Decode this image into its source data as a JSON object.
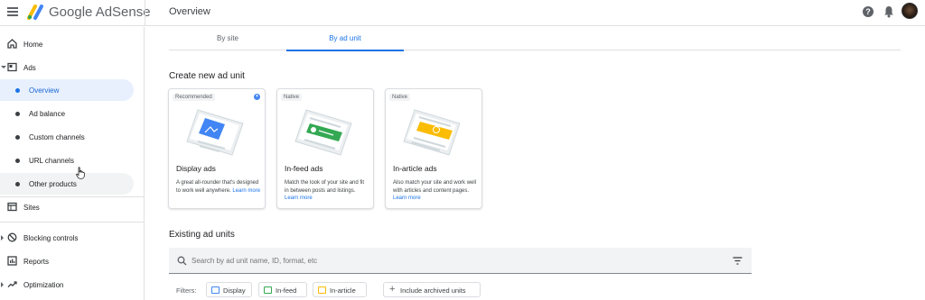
{
  "header": {
    "brand": "Google AdSense",
    "page_title": "Overview",
    "help_glyph": "?"
  },
  "sidebar": {
    "items": [
      {
        "label": "Home",
        "icon": "home-icon"
      },
      {
        "label": "Ads",
        "icon": "ads-icon"
      },
      {
        "label": "Sites",
        "icon": "sites-icon"
      },
      {
        "label": "Blocking controls",
        "icon": "block-icon"
      },
      {
        "label": "Reports",
        "icon": "reports-icon"
      },
      {
        "label": "Optimization",
        "icon": "trending-icon"
      }
    ],
    "ads_subitems": [
      {
        "label": "Overview",
        "active": true
      },
      {
        "label": "Ad balance"
      },
      {
        "label": "Custom channels"
      },
      {
        "label": "URL channels"
      },
      {
        "label": "Other products"
      }
    ]
  },
  "tabs": [
    {
      "label": "By site"
    },
    {
      "label": "By ad unit",
      "active": true
    }
  ],
  "create": {
    "title": "Create new ad unit",
    "cards": [
      {
        "badge": "Recommended",
        "title": "Display ads",
        "desc": "A great all-rounder that's designed to work well anywhere.",
        "link": "Learn more",
        "accent": "#4285f4"
      },
      {
        "badge": "Native",
        "title": "In-feed ads",
        "desc": "Match the look of your site and fit in between posts and listings.",
        "link": "Learn more",
        "accent": "#34a853"
      },
      {
        "badge": "Native",
        "title": "In-article ads",
        "desc": "Also match your site and work well with articles and content pages.",
        "link": "Learn more",
        "accent": "#fbbc04"
      }
    ]
  },
  "existing": {
    "title": "Existing ad units",
    "search_placeholder": "Search by ad unit name, ID, format, etc",
    "filters_label": "Filters:",
    "chips": [
      {
        "label": "Display",
        "color": "#4285f4"
      },
      {
        "label": "In-feed",
        "color": "#34a853"
      },
      {
        "label": "In-article",
        "color": "#fbbc04"
      },
      {
        "label": "Include archived units"
      }
    ]
  },
  "colors": {
    "accent": "#1a73e8",
    "active_bg": "#e8f0fe"
  }
}
